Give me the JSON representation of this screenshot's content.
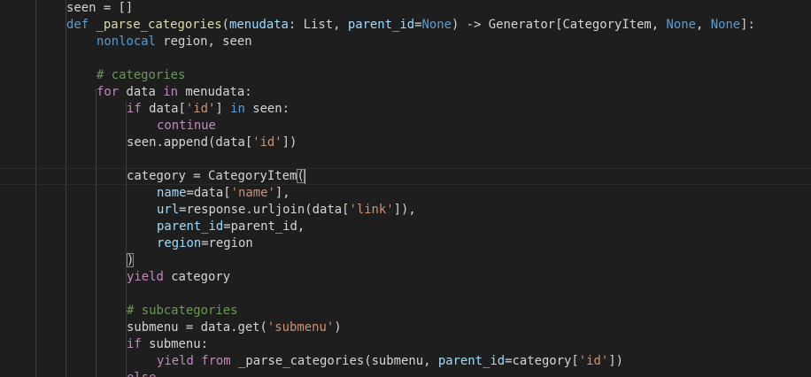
{
  "editor": {
    "language": "python",
    "theme_colors": {
      "background": "#1e1e1e",
      "keyword": "#569cd6",
      "control": "#c586c0",
      "function": "#dcdcaa",
      "class": "#4ec9b0",
      "variable": "#9cdcfe",
      "string": "#ce9178",
      "comment": "#6a9955",
      "text": "#d4d4d4"
    },
    "tokens": {
      "l1_seen": "seen",
      "l1_rest": " = []",
      "l2_def": "def",
      "l2_fn": "_parse_categories",
      "l2_p1": "(",
      "l2_menudata": "menudata",
      "l2_colon": ": ",
      "l2_List": "List",
      "l2_comma": ", ",
      "l2_parent": "parent_id",
      "l2_eq": "=",
      "l2_None1": "None",
      "l2_arrow": ") -> ",
      "l2_Gen": "Generator",
      "l2_lb": "[",
      "l2_Cat": "CategoryItem",
      "l2_c2": ", ",
      "l2_None2": "None",
      "l2_c3": ", ",
      "l2_None3": "None",
      "l2_end": "]:",
      "l3_nonlocal": "nonlocal",
      "l3_rest": " region, seen",
      "l5_comment": "# categories",
      "l6_for": "for",
      "l6_data": " data ",
      "l6_in": "in",
      "l6_rest": " menudata:",
      "l7_if": "if",
      "l7_data": " data[",
      "l7_str": "'id'",
      "l7_close": "] ",
      "l7_in": "in",
      "l7_rest": " seen:",
      "l8_continue": "continue",
      "l9_seen": "seen.",
      "l9_fn": "append",
      "l9_open": "(data[",
      "l9_str": "'id'",
      "l9_close": "])",
      "l11_cat": "category = ",
      "l11_cls": "CategoryItem",
      "l11_paren": "(",
      "l12_name": "name",
      "l12_eq": "=data[",
      "l12_str": "'name'",
      "l12_end": "],",
      "l13_url": "url",
      "l13_eq": "=response.",
      "l13_fn": "urljoin",
      "l13_open": "(data[",
      "l13_str": "'link'",
      "l13_end": "]),",
      "l14_parent": "parent_id",
      "l14_rest": "=parent_id,",
      "l15_region": "region",
      "l15_rest": "=region",
      "l16_paren": ")",
      "l17_yield": "yield",
      "l17_rest": " category",
      "l19_comment": "# subcategories",
      "l20_sub": "submenu = data.",
      "l20_fn": "get",
      "l20_open": "(",
      "l20_str": "'submenu'",
      "l20_end": ")",
      "l21_if": "if",
      "l21_rest": " submenu:",
      "l22_yield": "yield",
      "l22_sp1": " ",
      "l22_from": "from",
      "l22_sp2": " ",
      "l22_fn": "_parse_categories",
      "l22_open": "(submenu, ",
      "l22_parent": "parent_id",
      "l22_eq": "=category[",
      "l22_str": "'id'",
      "l22_end": "])",
      "l23_else": "else"
    }
  }
}
